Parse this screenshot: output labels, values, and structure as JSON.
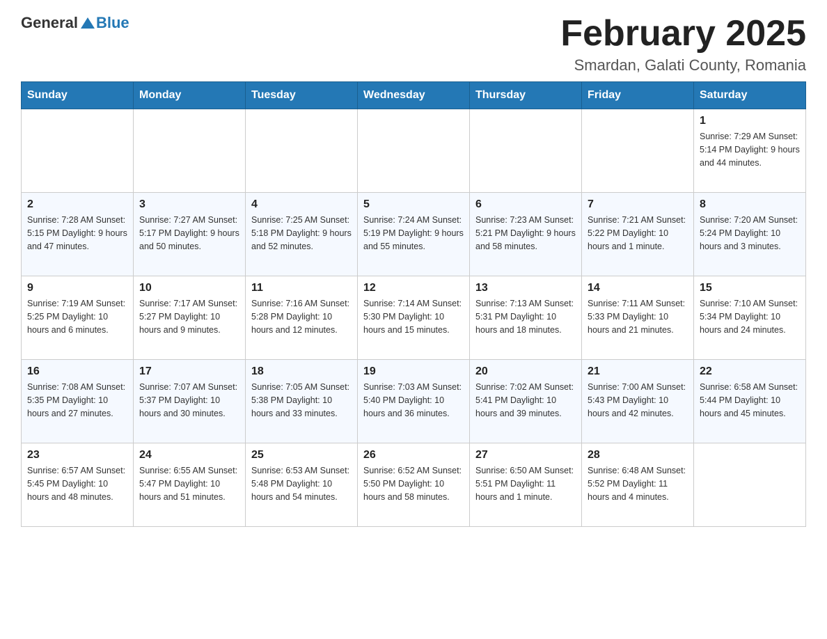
{
  "header": {
    "logo": {
      "text_general": "General",
      "text_blue": "Blue"
    },
    "month_title": "February 2025",
    "location": "Smardan, Galati County, Romania"
  },
  "weekdays": [
    "Sunday",
    "Monday",
    "Tuesday",
    "Wednesday",
    "Thursday",
    "Friday",
    "Saturday"
  ],
  "weeks": [
    [
      {
        "day": "",
        "info": ""
      },
      {
        "day": "",
        "info": ""
      },
      {
        "day": "",
        "info": ""
      },
      {
        "day": "",
        "info": ""
      },
      {
        "day": "",
        "info": ""
      },
      {
        "day": "",
        "info": ""
      },
      {
        "day": "1",
        "info": "Sunrise: 7:29 AM\nSunset: 5:14 PM\nDaylight: 9 hours and 44 minutes."
      }
    ],
    [
      {
        "day": "2",
        "info": "Sunrise: 7:28 AM\nSunset: 5:15 PM\nDaylight: 9 hours and 47 minutes."
      },
      {
        "day": "3",
        "info": "Sunrise: 7:27 AM\nSunset: 5:17 PM\nDaylight: 9 hours and 50 minutes."
      },
      {
        "day": "4",
        "info": "Sunrise: 7:25 AM\nSunset: 5:18 PM\nDaylight: 9 hours and 52 minutes."
      },
      {
        "day": "5",
        "info": "Sunrise: 7:24 AM\nSunset: 5:19 PM\nDaylight: 9 hours and 55 minutes."
      },
      {
        "day": "6",
        "info": "Sunrise: 7:23 AM\nSunset: 5:21 PM\nDaylight: 9 hours and 58 minutes."
      },
      {
        "day": "7",
        "info": "Sunrise: 7:21 AM\nSunset: 5:22 PM\nDaylight: 10 hours and 1 minute."
      },
      {
        "day": "8",
        "info": "Sunrise: 7:20 AM\nSunset: 5:24 PM\nDaylight: 10 hours and 3 minutes."
      }
    ],
    [
      {
        "day": "9",
        "info": "Sunrise: 7:19 AM\nSunset: 5:25 PM\nDaylight: 10 hours and 6 minutes."
      },
      {
        "day": "10",
        "info": "Sunrise: 7:17 AM\nSunset: 5:27 PM\nDaylight: 10 hours and 9 minutes."
      },
      {
        "day": "11",
        "info": "Sunrise: 7:16 AM\nSunset: 5:28 PM\nDaylight: 10 hours and 12 minutes."
      },
      {
        "day": "12",
        "info": "Sunrise: 7:14 AM\nSunset: 5:30 PM\nDaylight: 10 hours and 15 minutes."
      },
      {
        "day": "13",
        "info": "Sunrise: 7:13 AM\nSunset: 5:31 PM\nDaylight: 10 hours and 18 minutes."
      },
      {
        "day": "14",
        "info": "Sunrise: 7:11 AM\nSunset: 5:33 PM\nDaylight: 10 hours and 21 minutes."
      },
      {
        "day": "15",
        "info": "Sunrise: 7:10 AM\nSunset: 5:34 PM\nDaylight: 10 hours and 24 minutes."
      }
    ],
    [
      {
        "day": "16",
        "info": "Sunrise: 7:08 AM\nSunset: 5:35 PM\nDaylight: 10 hours and 27 minutes."
      },
      {
        "day": "17",
        "info": "Sunrise: 7:07 AM\nSunset: 5:37 PM\nDaylight: 10 hours and 30 minutes."
      },
      {
        "day": "18",
        "info": "Sunrise: 7:05 AM\nSunset: 5:38 PM\nDaylight: 10 hours and 33 minutes."
      },
      {
        "day": "19",
        "info": "Sunrise: 7:03 AM\nSunset: 5:40 PM\nDaylight: 10 hours and 36 minutes."
      },
      {
        "day": "20",
        "info": "Sunrise: 7:02 AM\nSunset: 5:41 PM\nDaylight: 10 hours and 39 minutes."
      },
      {
        "day": "21",
        "info": "Sunrise: 7:00 AM\nSunset: 5:43 PM\nDaylight: 10 hours and 42 minutes."
      },
      {
        "day": "22",
        "info": "Sunrise: 6:58 AM\nSunset: 5:44 PM\nDaylight: 10 hours and 45 minutes."
      }
    ],
    [
      {
        "day": "23",
        "info": "Sunrise: 6:57 AM\nSunset: 5:45 PM\nDaylight: 10 hours and 48 minutes."
      },
      {
        "day": "24",
        "info": "Sunrise: 6:55 AM\nSunset: 5:47 PM\nDaylight: 10 hours and 51 minutes."
      },
      {
        "day": "25",
        "info": "Sunrise: 6:53 AM\nSunset: 5:48 PM\nDaylight: 10 hours and 54 minutes."
      },
      {
        "day": "26",
        "info": "Sunrise: 6:52 AM\nSunset: 5:50 PM\nDaylight: 10 hours and 58 minutes."
      },
      {
        "day": "27",
        "info": "Sunrise: 6:50 AM\nSunset: 5:51 PM\nDaylight: 11 hours and 1 minute."
      },
      {
        "day": "28",
        "info": "Sunrise: 6:48 AM\nSunset: 5:52 PM\nDaylight: 11 hours and 4 minutes."
      },
      {
        "day": "",
        "info": ""
      }
    ]
  ]
}
